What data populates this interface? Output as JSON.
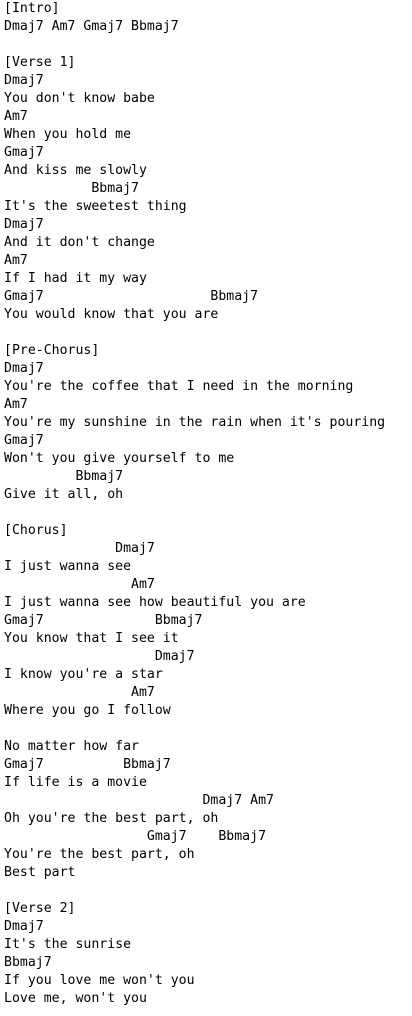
{
  "lines": [
    "[Intro]",
    "Dmaj7 Am7 Gmaj7 Bbmaj7",
    "",
    "[Verse 1]",
    "Dmaj7",
    "You don't know babe",
    "Am7",
    "When you hold me",
    "Gmaj7",
    "And kiss me slowly",
    "           Bbmaj7",
    "It's the sweetest thing",
    "Dmaj7",
    "And it don't change",
    "Am7",
    "If I had it my way",
    "Gmaj7                     Bbmaj7",
    "You would know that you are",
    "",
    "[Pre-Chorus]",
    "Dmaj7",
    "You're the coffee that I need in the morning",
    "Am7",
    "You're my sunshine in the rain when it's pouring",
    "Gmaj7",
    "Won't you give yourself to me",
    "         Bbmaj7",
    "Give it all, oh",
    "",
    "[Chorus]",
    "              Dmaj7",
    "I just wanna see",
    "                Am7",
    "I just wanna see how beautiful you are",
    "Gmaj7              Bbmaj7",
    "You know that I see it",
    "                   Dmaj7",
    "I know you're a star",
    "                Am7",
    "Where you go I follow",
    "",
    "No matter how far",
    "Gmaj7          Bbmaj7",
    "If life is a movie",
    "                         Dmaj7 Am7",
    "Oh you're the best part, oh",
    "                  Gmaj7    Bbmaj7",
    "You're the best part, oh",
    "Best part",
    "",
    "[Verse 2]",
    "Dmaj7",
    "It's the sunrise",
    "Bbmaj7",
    "If you love me won't you",
    "Love me, won't you"
  ]
}
